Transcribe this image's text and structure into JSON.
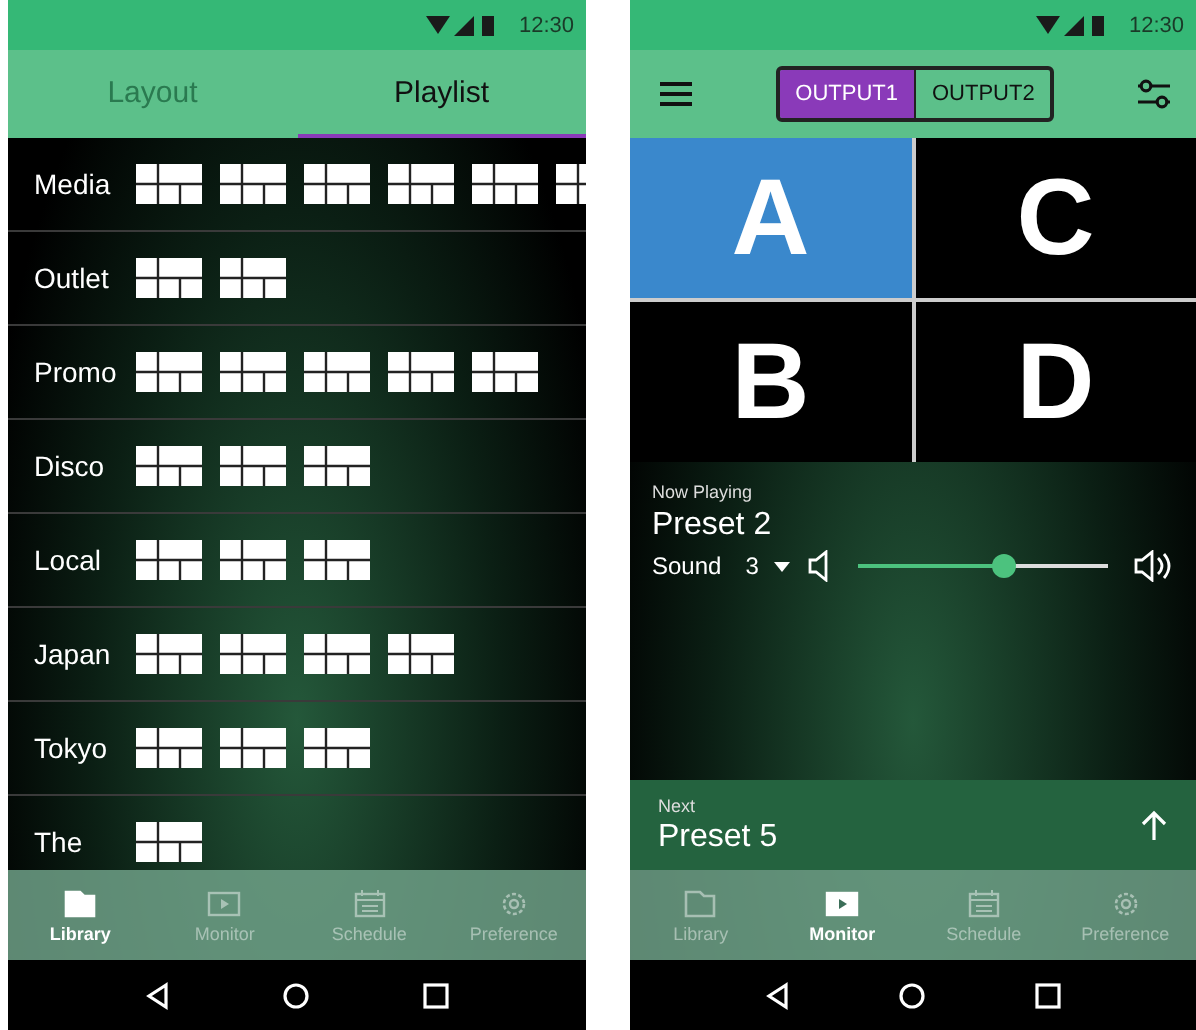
{
  "library_screen": {
    "status_bar": {
      "time": "12:30"
    },
    "tabs": [
      {
        "label": "Layout",
        "selected": false
      },
      {
        "label": "Playlist",
        "selected": true
      }
    ],
    "playlists": [
      {
        "name": "Media",
        "layouts": [
          {
            "kind": "grid"
          },
          {
            "kind": "grid"
          },
          {
            "kind": "grid"
          },
          {
            "kind": "grid"
          },
          {
            "kind": "grid"
          },
          {
            "kind": "grid"
          }
        ]
      },
      {
        "name": "Outlet",
        "layouts": [
          {
            "kind": "grid"
          },
          {
            "kind": "grid"
          }
        ]
      },
      {
        "name": "Promo",
        "layouts": [
          {
            "kind": "grid"
          },
          {
            "kind": "grid"
          },
          {
            "kind": "grid"
          },
          {
            "kind": "grid"
          },
          {
            "kind": "grid"
          }
        ]
      },
      {
        "name": "Disco",
        "layouts": [
          {
            "kind": "grid"
          },
          {
            "kind": "grid"
          },
          {
            "kind": "grid"
          }
        ]
      },
      {
        "name": "Local",
        "layouts": [
          {
            "kind": "grid"
          },
          {
            "kind": "grid"
          },
          {
            "kind": "grid"
          }
        ]
      },
      {
        "name": "Japan",
        "layouts": [
          {
            "kind": "grid"
          },
          {
            "kind": "grid"
          },
          {
            "kind": "grid"
          },
          {
            "kind": "grid"
          }
        ]
      },
      {
        "name": "Tokyo",
        "layouts": [
          {
            "kind": "grid"
          },
          {
            "kind": "grid"
          },
          {
            "kind": "grid"
          }
        ]
      },
      {
        "name": "The",
        "layouts": [
          {
            "kind": "grid"
          }
        ]
      }
    ],
    "bottom_nav": [
      {
        "label": "Library",
        "kind": "folder",
        "selected": true
      },
      {
        "label": "Monitor",
        "kind": "play",
        "selected": false
      },
      {
        "label": "Schedule",
        "kind": "calendar",
        "selected": false
      },
      {
        "label": "Preference",
        "kind": "gear",
        "selected": false
      }
    ]
  },
  "monitor_screen": {
    "status_bar": {
      "time": "12:30"
    },
    "outputs": [
      {
        "label": "OUTPUT1",
        "selected": true
      },
      {
        "label": "OUTPUT2",
        "selected": false
      }
    ],
    "zones": [
      {
        "label": "A",
        "selected": true
      },
      {
        "label": "C",
        "selected": false
      },
      {
        "label": "B",
        "selected": false
      },
      {
        "label": "D",
        "selected": false
      }
    ],
    "now_playing": {
      "heading": "Now Playing",
      "title": "Preset 2",
      "sound_label": "Sound",
      "sound_value": "3",
      "volume": {
        "level": 0.58
      }
    },
    "next": {
      "heading": "Next",
      "title": "Preset 5"
    },
    "bottom_nav": [
      {
        "label": "Library",
        "kind": "folder",
        "selected": false
      },
      {
        "label": "Monitor",
        "kind": "play",
        "selected": true
      },
      {
        "label": "Schedule",
        "kind": "calendar",
        "selected": false
      },
      {
        "label": "Preference",
        "kind": "gear",
        "selected": false
      }
    ]
  }
}
